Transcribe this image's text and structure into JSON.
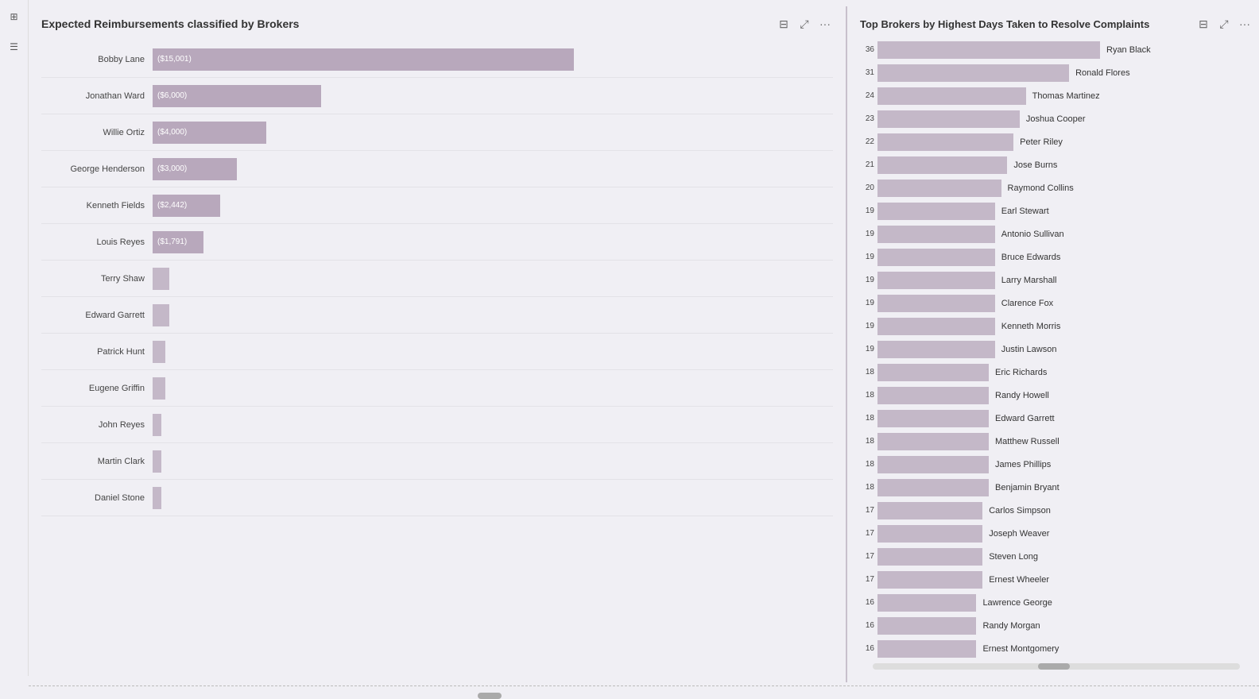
{
  "sidebar": {
    "icons": [
      {
        "name": "grid-icon",
        "glyph": "⊞"
      },
      {
        "name": "chart-icon",
        "glyph": "≡"
      }
    ]
  },
  "left_chart": {
    "title": "Expected Reimbursements classified by Brokers",
    "controls": [
      "filter-icon",
      "expand-icon",
      "more-icon"
    ],
    "bars": [
      {
        "label": "Bobby Lane",
        "value": "($15,001)",
        "width_pct": 100,
        "color": "#b8a8bc"
      },
      {
        "label": "Jonathan Ward",
        "value": "($6,000)",
        "width_pct": 40,
        "color": "#b8a8bc"
      },
      {
        "label": "Willie Ortiz",
        "value": "($4,000)",
        "width_pct": 27,
        "color": "#b8a8bc"
      },
      {
        "label": "George Henderson",
        "value": "($3,000)",
        "width_pct": 20,
        "color": "#b8a8bc"
      },
      {
        "label": "Kenneth Fields",
        "value": "($2,442)",
        "width_pct": 16,
        "color": "#b8a8bc"
      },
      {
        "label": "Louis Reyes",
        "value": "($1,791)",
        "width_pct": 12,
        "color": "#b8a8bc"
      },
      {
        "label": "Terry Shaw",
        "value": "",
        "width_pct": 4,
        "color": "#c4b8c8"
      },
      {
        "label": "Edward Garrett",
        "value": "",
        "width_pct": 4,
        "color": "#c4b8c8"
      },
      {
        "label": "Patrick Hunt",
        "value": "",
        "width_pct": 3,
        "color": "#c4b8c8"
      },
      {
        "label": "Eugene Griffin",
        "value": "",
        "width_pct": 3,
        "color": "#c4b8c8"
      },
      {
        "label": "John Reyes",
        "value": "",
        "width_pct": 2,
        "color": "#c4b8c8"
      },
      {
        "label": "Martin Clark",
        "value": "",
        "width_pct": 2,
        "color": "#c4b8c8"
      },
      {
        "label": "Daniel Stone",
        "value": "",
        "width_pct": 2,
        "color": "#c4b8c8"
      }
    ]
  },
  "right_chart": {
    "title": "Top Brokers by Highest Days Taken to Resolve Complaints",
    "bars": [
      {
        "name": "Ryan Black",
        "value": 36
      },
      {
        "name": "Ronald Flores",
        "value": 31
      },
      {
        "name": "Thomas Martinez",
        "value": 24
      },
      {
        "name": "Joshua Cooper",
        "value": 23
      },
      {
        "name": "Peter Riley",
        "value": 22
      },
      {
        "name": "Jose Burns",
        "value": 21
      },
      {
        "name": "Raymond Collins",
        "value": 20
      },
      {
        "name": "Earl Stewart",
        "value": 19
      },
      {
        "name": "Antonio Sullivan",
        "value": 19
      },
      {
        "name": "Bruce Edwards",
        "value": 19
      },
      {
        "name": "Larry Marshall",
        "value": 19
      },
      {
        "name": "Clarence Fox",
        "value": 19
      },
      {
        "name": "Kenneth Morris",
        "value": 19
      },
      {
        "name": "Justin Lawson",
        "value": 19
      },
      {
        "name": "Eric Richards",
        "value": 18
      },
      {
        "name": "Randy Howell",
        "value": 18
      },
      {
        "name": "Edward Garrett",
        "value": 18
      },
      {
        "name": "Matthew Russell",
        "value": 18
      },
      {
        "name": "James Phillips",
        "value": 18
      },
      {
        "name": "Benjamin Bryant",
        "value": 18
      },
      {
        "name": "Carlos Simpson",
        "value": 17
      },
      {
        "name": "Joseph Weaver",
        "value": 17
      },
      {
        "name": "Steven Long",
        "value": 17
      },
      {
        "name": "Ernest Wheeler",
        "value": 17
      },
      {
        "name": "Lawrence George",
        "value": 16
      },
      {
        "name": "Randy Morgan",
        "value": 16
      },
      {
        "name": "Ernest Montgomery",
        "value": 16
      }
    ],
    "max_value": 36
  }
}
